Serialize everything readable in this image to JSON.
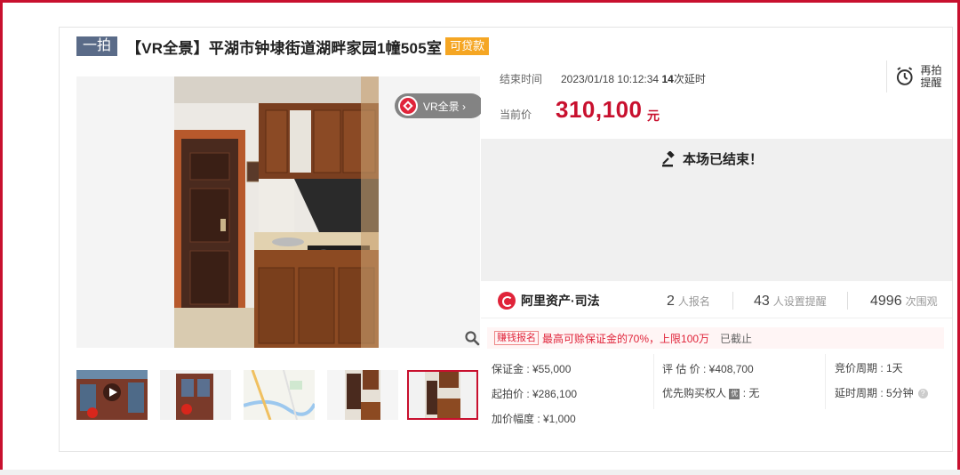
{
  "title": {
    "round_tag": "一拍",
    "text": "【VR全景】平湖市钟埭街道湖畔家园1幢505室",
    "loan_tag": "可贷款"
  },
  "photo": {
    "vr_label": "VR全景 ›",
    "zoom_icon": "search-icon"
  },
  "thumbnails": [
    {
      "kind": "video",
      "active": false
    },
    {
      "kind": "building",
      "active": false
    },
    {
      "kind": "map",
      "active": false
    },
    {
      "kind": "interior",
      "active": false
    },
    {
      "kind": "kitchen",
      "active": true
    }
  ],
  "auction": {
    "end_label": "结束时间",
    "end_time": "2023/01/18 10:12:34",
    "delay_count": "14",
    "delay_suffix": "次延时",
    "remind_label": "再拍提醒",
    "price_label": "当前价",
    "price_value": "310,100",
    "price_unit": "元",
    "ended_text": "本场已结束！"
  },
  "stats": {
    "brand": "阿里资产·司法",
    "signups_count": "2",
    "signups_label": "人报名",
    "reminders_count": "43",
    "reminders_label": "人设置提醒",
    "views_count": "4996",
    "views_label": "次围观"
  },
  "notice": {
    "tag": "赚钱报名",
    "text": "最高可赊保证金的70%，上限100万",
    "status": "已截止"
  },
  "details": {
    "deposit": "保证金 : ¥55,000",
    "start_price": "起拍价 : ¥286,100",
    "increment": "加价幅度 : ¥1,000",
    "appraisal": "评 估 价 : ¥408,700",
    "priority_label": "优先购买权人",
    "priority_value": ": 无",
    "cycle": "竞价周期 : 1天",
    "delay_cycle": "延时周期 : 5分钟"
  },
  "colors": {
    "accent": "#c8102e",
    "tag_blue": "#5a6b88",
    "loan_orange": "#f5a623"
  }
}
